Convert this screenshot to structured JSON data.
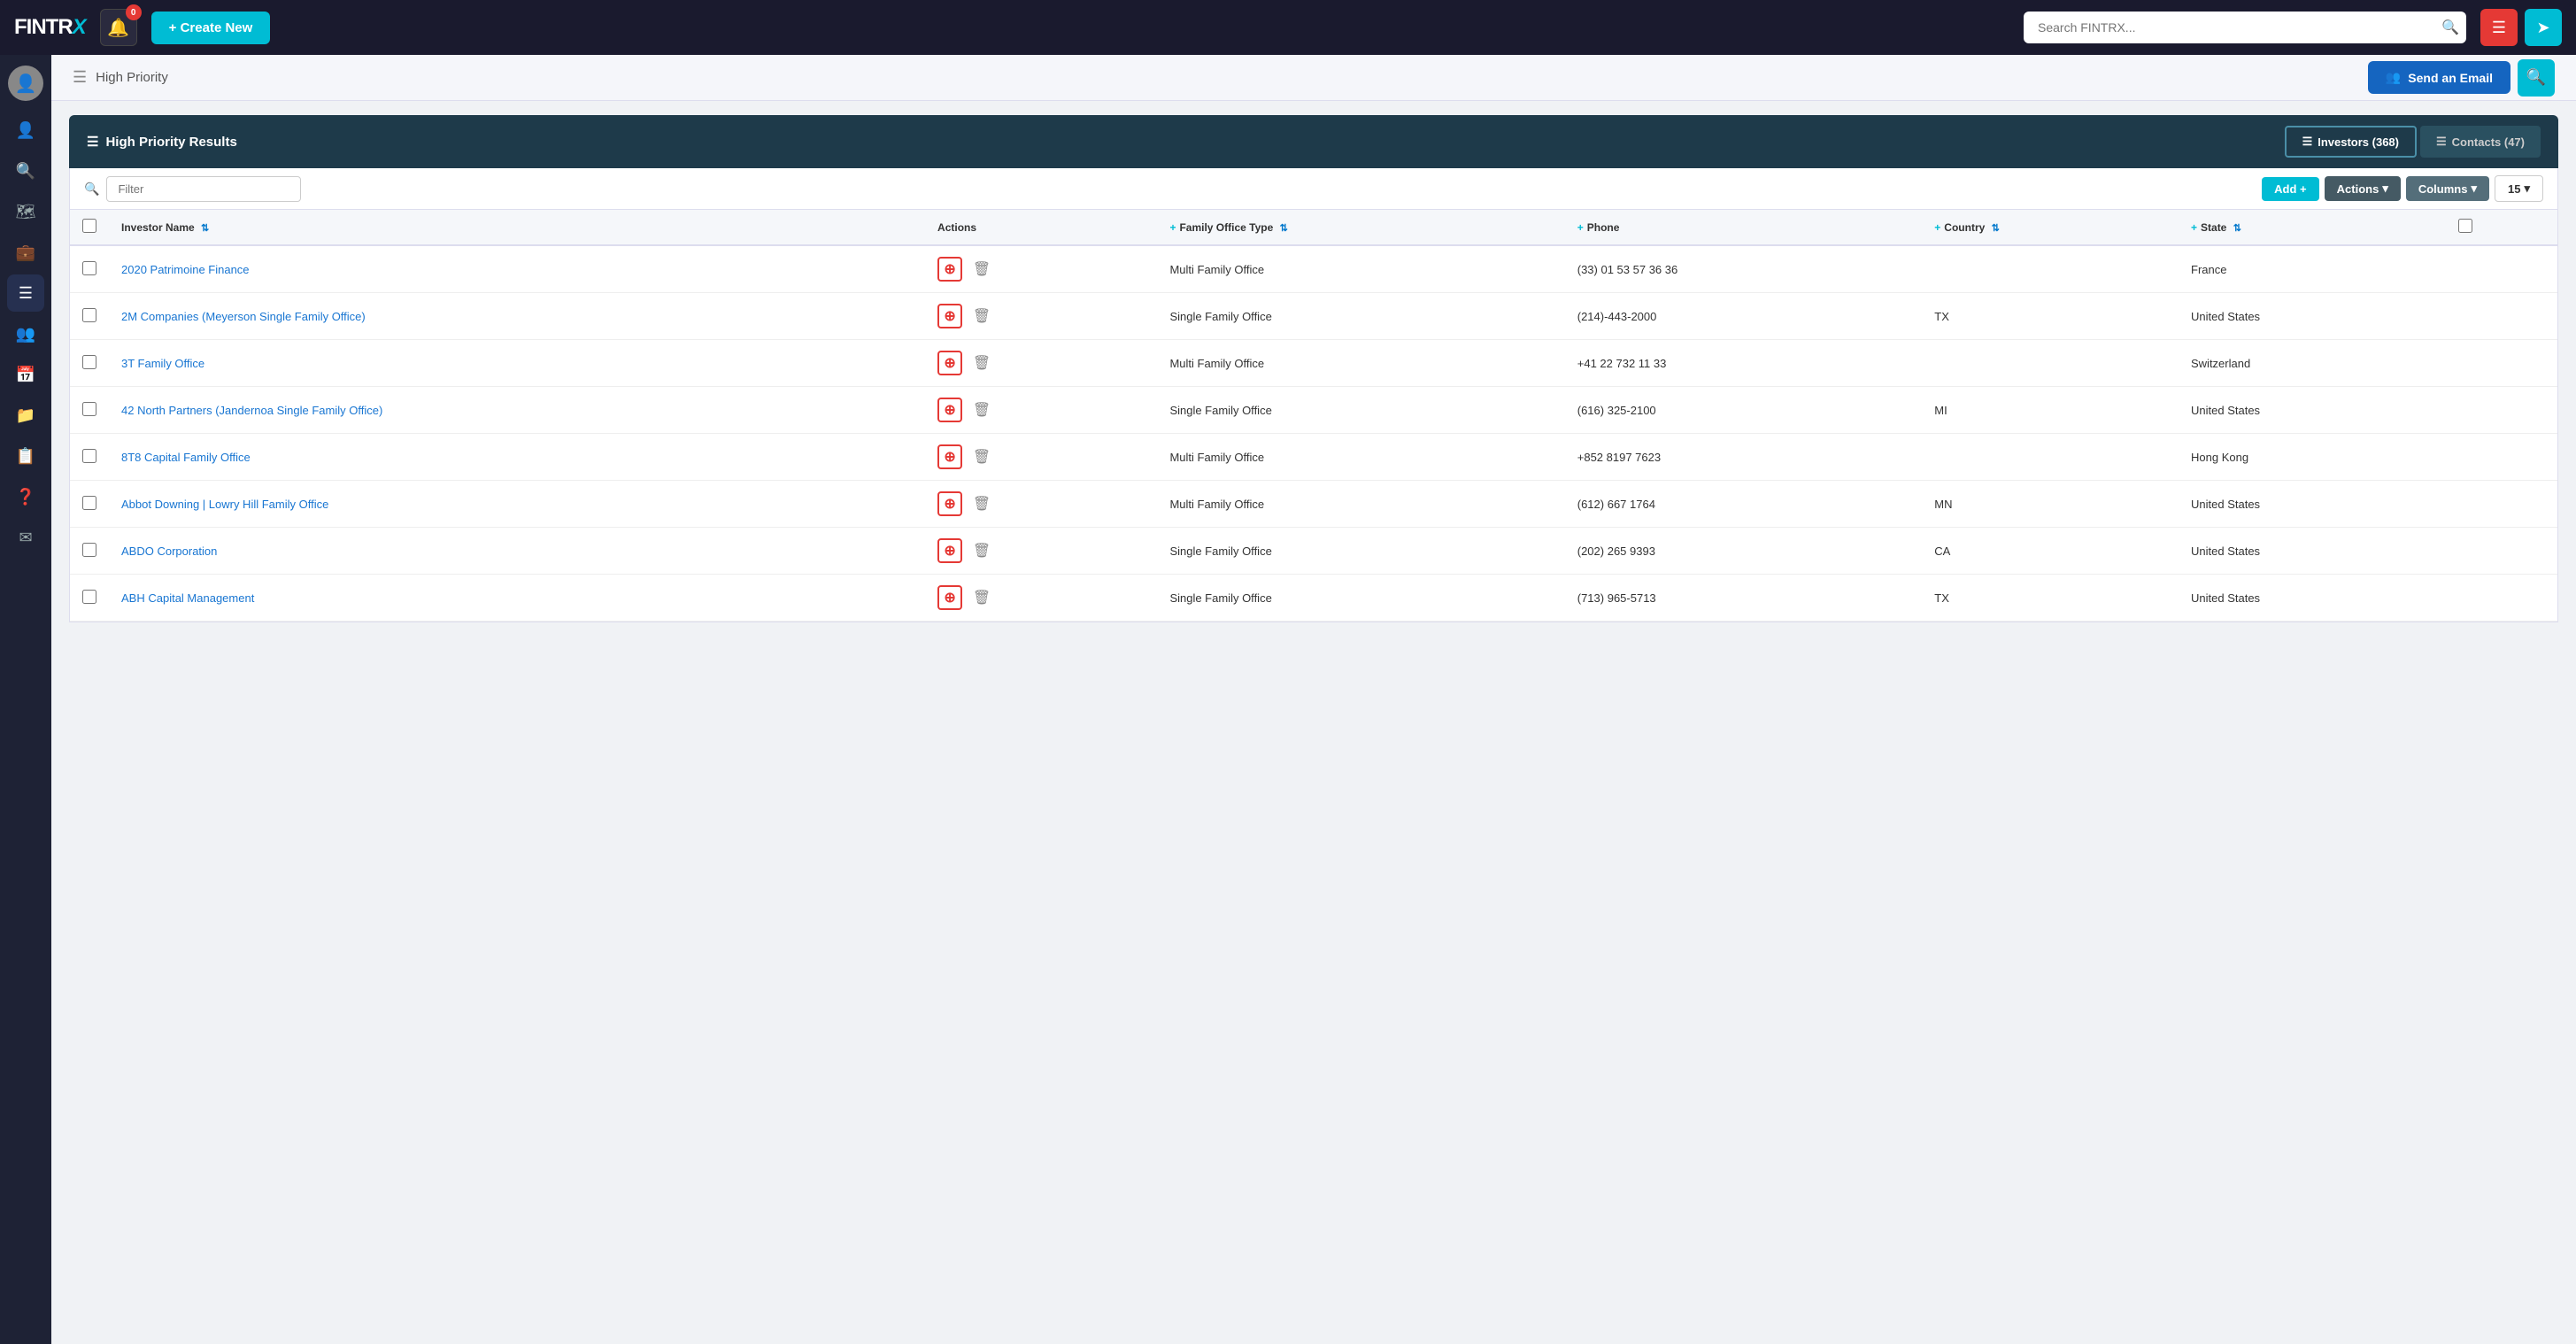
{
  "app": {
    "logo_text": "FINTRX",
    "notification_count": "0",
    "create_new_label": "+ Create New",
    "search_placeholder": "Search FINTRX...",
    "send_email_label": "Send an Email",
    "breadcrumb_label": "High Priority",
    "results_title": "High Priority Results",
    "investors_tab": "Investors (368)",
    "contacts_tab": "Contacts (47)",
    "filter_placeholder": "Filter",
    "add_btn": "Add +",
    "actions_btn": "Actions",
    "columns_btn": "Columns",
    "count_value": "15"
  },
  "columns": [
    {
      "label": "Investor Name",
      "sortable": true,
      "prefix": ""
    },
    {
      "label": "Actions",
      "sortable": false,
      "prefix": ""
    },
    {
      "label": "Family Office Type",
      "sortable": true,
      "prefix": "+"
    },
    {
      "label": "Phone",
      "sortable": false,
      "prefix": "+"
    },
    {
      "label": "Country",
      "sortable": true,
      "prefix": "+"
    },
    {
      "label": "State",
      "sortable": true,
      "prefix": "+"
    }
  ],
  "rows": [
    {
      "name": "2020 Patrimoine Finance",
      "family_office_type": "Multi Family Office",
      "phone": "(33) 01 53 57 36 36",
      "country": "",
      "state": "France"
    },
    {
      "name": "2M Companies (Meyerson Single Family Office)",
      "family_office_type": "Single Family Office",
      "phone": "(214)-443-2000",
      "country": "TX",
      "state": "United States"
    },
    {
      "name": "3T Family Office",
      "family_office_type": "Multi Family Office",
      "phone": "+41 22 732 11 33",
      "country": "",
      "state": "Switzerland"
    },
    {
      "name": "42 North Partners (Jandernoa Single Family Office)",
      "family_office_type": "Single Family Office",
      "phone": "(616) 325-2100",
      "country": "MI",
      "state": "United States"
    },
    {
      "name": "8T8 Capital Family Office",
      "family_office_type": "Multi Family Office",
      "phone": "+852 8197 7623",
      "country": "",
      "state": "Hong Kong"
    },
    {
      "name": "Abbot Downing | Lowry Hill Family Office",
      "family_office_type": "Multi Family Office",
      "phone": "(612) 667 1764",
      "country": "MN",
      "state": "United States"
    },
    {
      "name": "ABDO Corporation",
      "family_office_type": "Single Family Office",
      "phone": "(202) 265 9393",
      "country": "CA",
      "state": "United States"
    },
    {
      "name": "ABH Capital Management",
      "family_office_type": "Single Family Office",
      "phone": "(713) 965-5713",
      "country": "TX",
      "state": "United States"
    }
  ],
  "sidebar": {
    "items": [
      {
        "icon": "👤",
        "name": "profile"
      },
      {
        "icon": "🔍",
        "name": "search"
      },
      {
        "icon": "🗺️",
        "name": "map"
      },
      {
        "icon": "💼",
        "name": "briefcase"
      },
      {
        "icon": "☰",
        "name": "list"
      },
      {
        "icon": "👥",
        "name": "group"
      },
      {
        "icon": "📅",
        "name": "calendar"
      },
      {
        "icon": "📁",
        "name": "folder"
      },
      {
        "icon": "📋",
        "name": "document"
      },
      {
        "icon": "❓",
        "name": "help"
      },
      {
        "icon": "✉️",
        "name": "email"
      }
    ]
  }
}
